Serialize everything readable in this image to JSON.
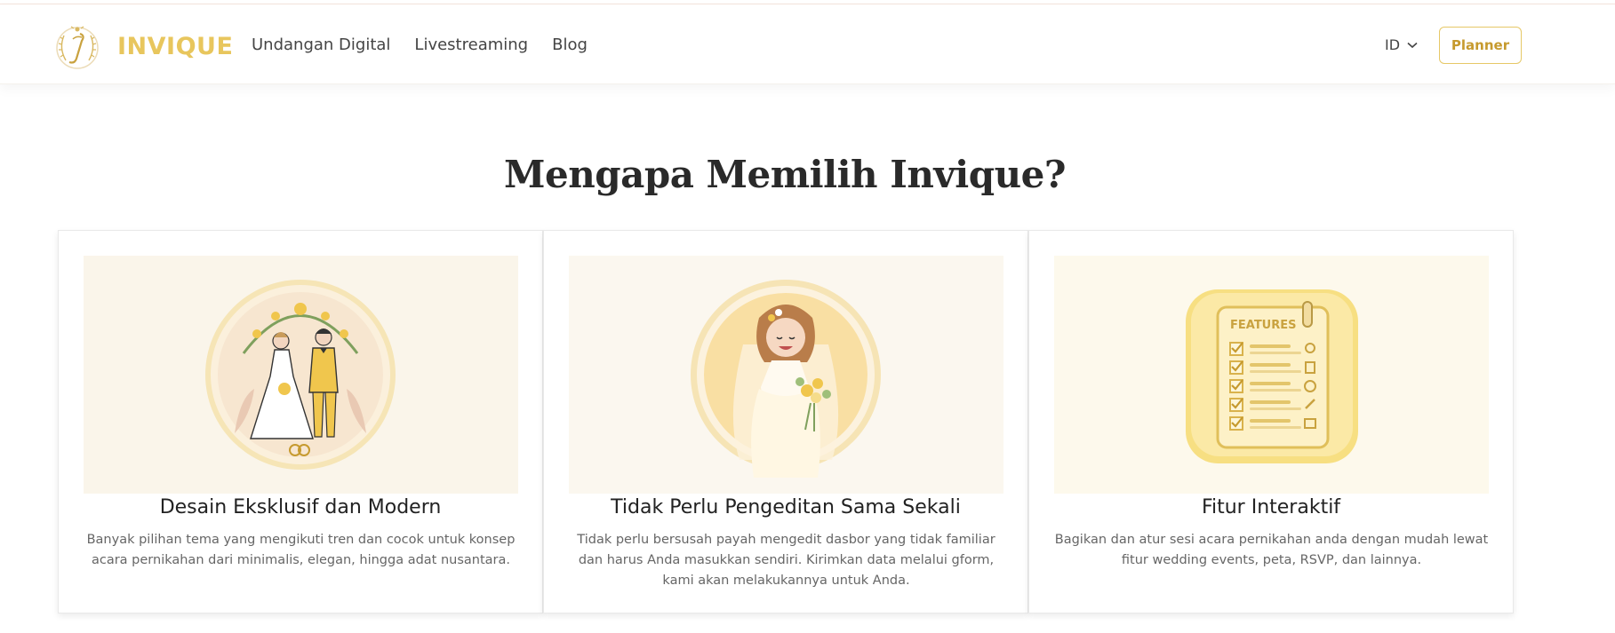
{
  "header": {
    "brand": "INVIQUE",
    "nav": [
      {
        "label": "Undangan Digital"
      },
      {
        "label": "Livestreaming"
      },
      {
        "label": "Blog"
      }
    ],
    "language": "ID",
    "planner_label": "Planner"
  },
  "main": {
    "title": "Mengapa Memilih Invique?",
    "cards": [
      {
        "title": "Desain Eksklusif dan Modern",
        "description": "Banyak pilihan tema yang mengikuti tren dan cocok untuk konsep acara pernikahan dari minimalis, elegan, hingga adat nusantara.",
        "image": "bride-and-groom-illustration"
      },
      {
        "title": "Tidak Perlu Pengeditan Sama Sekali",
        "description": "Tidak perlu bersusah payah mengedit dasbor yang tidak familiar dan harus Anda masukkan sendiri. Kirimkan data melalui gform, kami akan melakukannya untuk Anda.",
        "image": "smiling-bride-illustration"
      },
      {
        "title": "Fitur Interaktif",
        "description": "Bagikan dan atur sesi acara pernikahan anda dengan mudah lewat fitur wedding events, peta, RSVP, dan lainnya.",
        "image": "features-checklist-icon",
        "image_text": "FEATURES"
      }
    ]
  },
  "colors": {
    "brand": "#e8c65d",
    "planner_text": "#c69a2e",
    "title": "#2a2a2a"
  }
}
